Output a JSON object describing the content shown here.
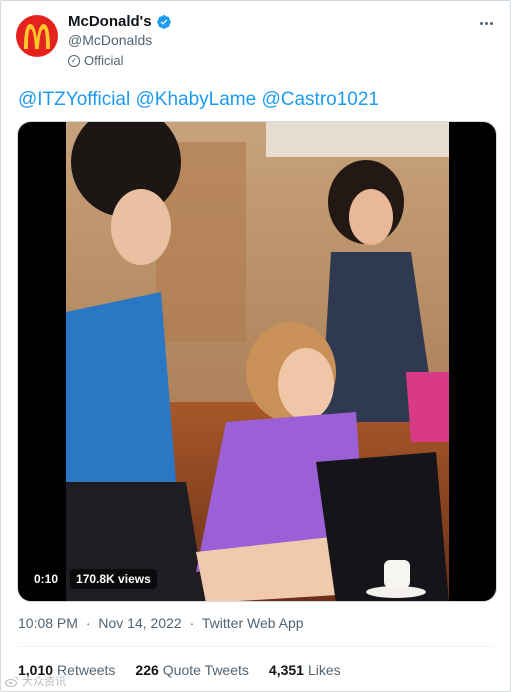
{
  "account": {
    "display_name": "McDonald's",
    "handle": "@McDonalds",
    "official_label": "Official",
    "avatar_icon": "golden-arches-logo",
    "brand_color": "#e4231f",
    "arches_color": "#ffc72c",
    "verified_color": "#1d9bf0"
  },
  "tweet": {
    "mentions": [
      "@ITZYofficial",
      "@KhabyLame",
      "@Castro1021"
    ],
    "mention_color": "#1d9bf0"
  },
  "media": {
    "type": "video",
    "duration": "0:10",
    "views": "170.8K views"
  },
  "meta": {
    "time": "10:08 PM",
    "separator": "·",
    "date": "Nov 14, 2022",
    "source": "Twitter Web App"
  },
  "stats": {
    "retweets_count": "1,010",
    "retweets_label": "Retweets",
    "quotes_count": "226",
    "quotes_label": "Quote Tweets",
    "likes_count": "4,351",
    "likes_label": "Likes"
  },
  "watermark": {
    "text": "大众资讯"
  }
}
